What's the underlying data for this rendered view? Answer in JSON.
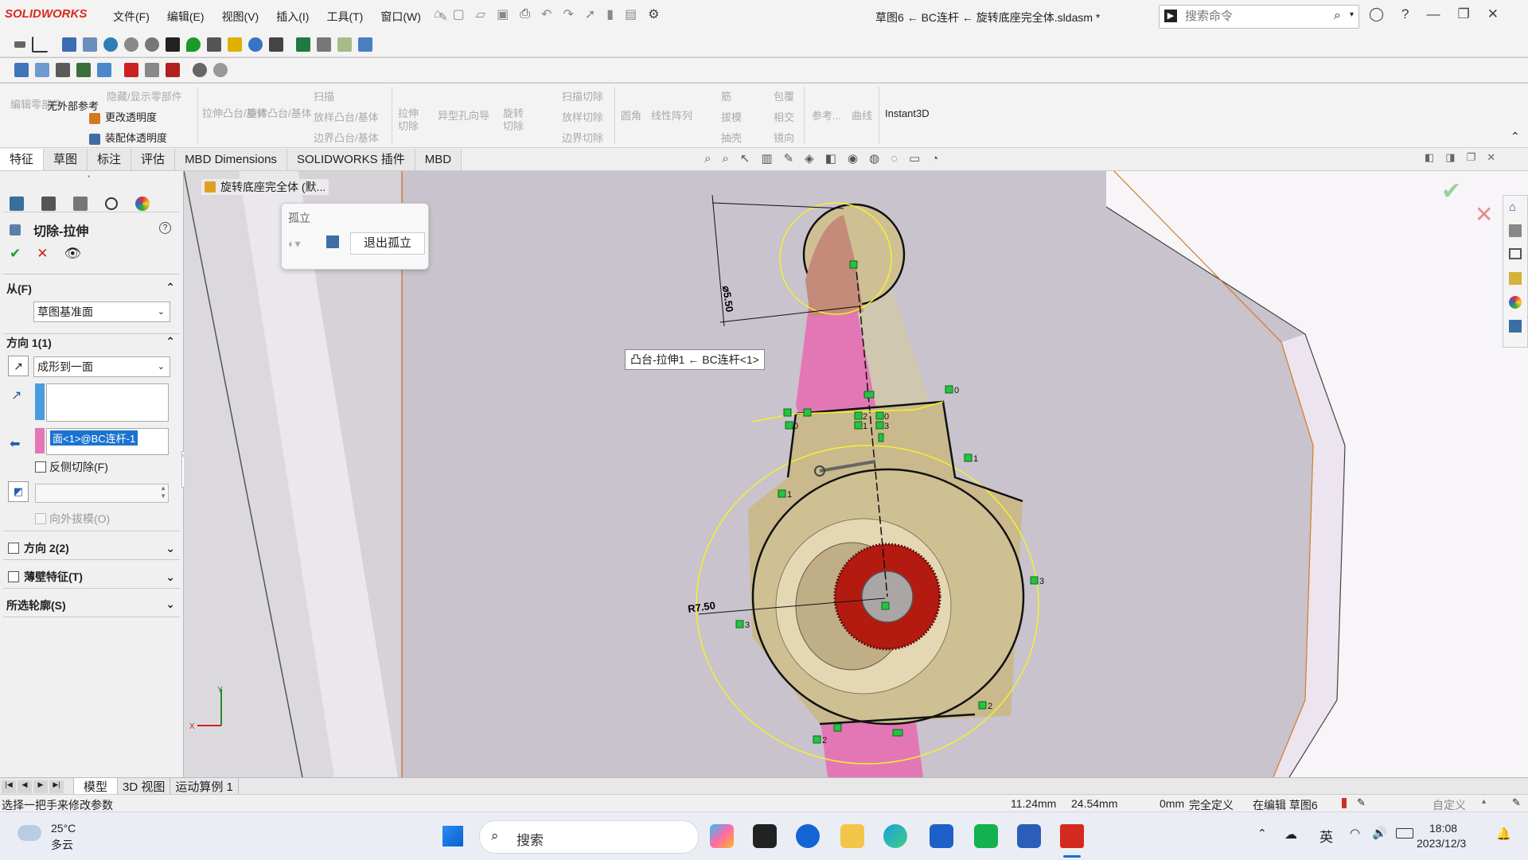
{
  "app": {
    "logo": "SOLIDWORKS",
    "document_title": "草图6 ← BC连杆 ← 旋转底座完全体.sldasm *"
  },
  "menu": [
    "文件(F)",
    "编辑(E)",
    "视图(V)",
    "插入(I)",
    "工具(T)",
    "窗口(W)"
  ],
  "search": {
    "placeholder": "搜索命令"
  },
  "command_manager": {
    "edit_part": "编辑零部件",
    "no_external_refs": "无外部参考",
    "hide_show": "隐藏/显示零部件",
    "change_transparency": "更改透明度",
    "assembly_transparency": "装配体透明度",
    "extrude_boss": "拉伸凸台/基体",
    "revolve_boss": "旋转凸台/基体",
    "sweep": "扫描",
    "loft_boss": "放样凸台/基体",
    "boundary_boss": "边界凸台/基体",
    "extrude_cut": "拉伸切除",
    "hole_wizard": "异型孔向导",
    "revolve_cut": "旋转切除",
    "swept_cut": "扫描切除",
    "lofted_cut": "放样切除",
    "boundary_cut": "边界切除",
    "fillet": "圆角",
    "linear_pattern": "线性阵列",
    "rib": "筋",
    "draft": "拔模",
    "shell": "抽壳",
    "wrap": "包覆",
    "intersect": "相交",
    "mirror": "镜向",
    "reference": "参考...",
    "curves": "曲线",
    "instant3d": "Instant3D"
  },
  "tabs": [
    "特征",
    "草图",
    "标注",
    "评估",
    "MBD Dimensions",
    "SOLIDWORKS 插件",
    "MBD"
  ],
  "tree_root": "旋转底座完全体 (默...",
  "panel": {
    "title": "切除-拉伸",
    "from_label": "从(F)",
    "from_value": "草图基准面",
    "dir1_label": "方向 1(1)",
    "dir1_end": "成形到一面",
    "face_ref": "面<1>@BC连杆-1",
    "flip_side": "反侧切除(F)",
    "draft_outward": "向外拔模(O)",
    "dir2_label": "方向 2(2)",
    "thin_label": "薄壁特征(T)",
    "contours_label": "所选轮廓(S)"
  },
  "isolate": {
    "title": "孤立",
    "exit": "退出孤立"
  },
  "viewport": {
    "tooltip": "凸台-拉伸1 ← BC连杆<1>",
    "dim_dia": "⌀5.50",
    "dim_radius": "R7.50",
    "triad_y": "Y",
    "triad_x": "X",
    "relation_labels": [
      "0",
      "1",
      "2",
      "3"
    ]
  },
  "model_tabs": [
    "模型",
    "3D 视图",
    "运动算例 1"
  ],
  "status": {
    "message": "选择一把手来修改参数",
    "x": "11.24mm",
    "y": "24.54mm",
    "z": "0mm",
    "defined": "完全定义",
    "editing": "在编辑 草图6",
    "custom": "自定义"
  },
  "taskbar": {
    "temp": "25°C",
    "weather": "多云",
    "search": "搜索",
    "ime": "英",
    "time": "18:08",
    "date": "2023/12/3"
  },
  "colors": {
    "accent": "#d52b1e",
    "pink": "#e377b6",
    "tan": "#c9b98c",
    "red": "#b31a10"
  }
}
